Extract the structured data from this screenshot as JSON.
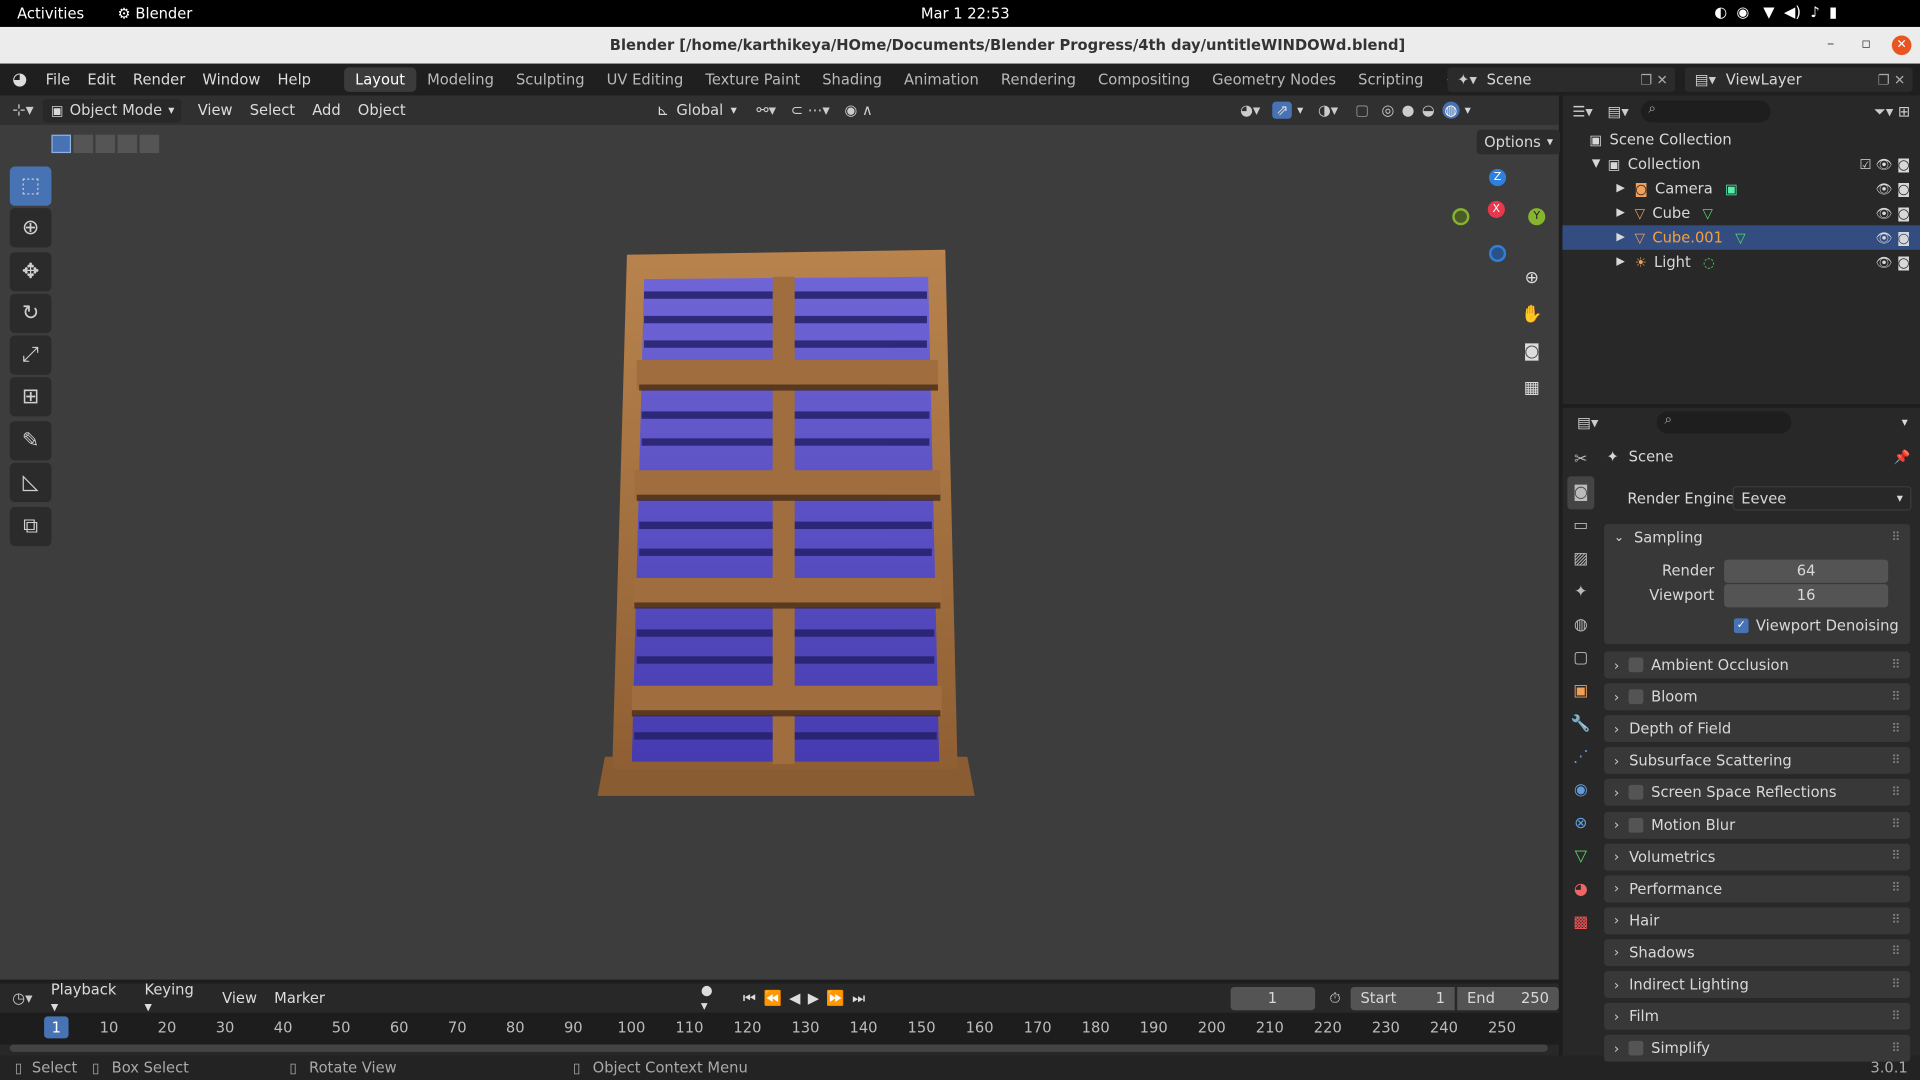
{
  "os": {
    "activities": "Activities",
    "app": "Blender",
    "clock": "Mar 1  22:53"
  },
  "window": {
    "title": "Blender [/home/karthikeya/HOme/Documents/Blender Progress/4th day/untitleWINDOWd.blend]"
  },
  "menu": {
    "items": [
      "File",
      "Edit",
      "Render",
      "Window",
      "Help"
    ]
  },
  "workspaces": {
    "tabs": [
      "Layout",
      "Modeling",
      "Sculpting",
      "UV Editing",
      "Texture Paint",
      "Shading",
      "Animation",
      "Rendering",
      "Compositing",
      "Geometry Nodes",
      "Scripting"
    ],
    "add": "+"
  },
  "scene": {
    "name": "Scene",
    "view_layer": "ViewLayer"
  },
  "viewport": {
    "mode": "Object Mode",
    "menus": [
      "View",
      "Select",
      "Add",
      "Object"
    ],
    "orientation": "Global",
    "options": "Options",
    "gizmo": {
      "x": "X",
      "y": "Y",
      "z": "Z"
    }
  },
  "outliner": {
    "root": "Scene Collection",
    "collection": "Collection",
    "items": [
      {
        "name": "Camera",
        "icon": "camera-icon"
      },
      {
        "name": "Cube",
        "icon": "mesh-icon"
      },
      {
        "name": "Cube.001",
        "icon": "mesh-icon",
        "selected": true
      },
      {
        "name": "Light",
        "icon": "light-icon"
      }
    ]
  },
  "properties": {
    "context": "Scene",
    "render_engine_label": "Render Engine",
    "render_engine": "Eevee",
    "sampling": {
      "label": "Sampling",
      "render_label": "Render",
      "render": "64",
      "viewport_label": "Viewport",
      "viewport": "16",
      "denoise": "Viewport Denoising"
    },
    "panels": [
      {
        "label": "Ambient Occlusion",
        "checkbox": true
      },
      {
        "label": "Bloom",
        "checkbox": true
      },
      {
        "label": "Depth of Field",
        "checkbox": false
      },
      {
        "label": "Subsurface Scattering",
        "checkbox": false
      },
      {
        "label": "Screen Space Reflections",
        "checkbox": true
      },
      {
        "label": "Motion Blur",
        "checkbox": true
      },
      {
        "label": "Volumetrics",
        "checkbox": false
      },
      {
        "label": "Performance",
        "checkbox": false
      },
      {
        "label": "Hair",
        "checkbox": false
      },
      {
        "label": "Shadows",
        "checkbox": false
      },
      {
        "label": "Indirect Lighting",
        "checkbox": false
      },
      {
        "label": "Film",
        "checkbox": false
      },
      {
        "label": "Simplify",
        "checkbox": true
      }
    ]
  },
  "timeline": {
    "menus": [
      "Playback",
      "Keying",
      "View",
      "Marker"
    ],
    "current_frame": "1",
    "start_label": "Start",
    "start": "1",
    "end_label": "End",
    "end": "250",
    "ruler": [
      "1",
      "10",
      "20",
      "30",
      "40",
      "50",
      "60",
      "70",
      "80",
      "90",
      "100",
      "110",
      "120",
      "130",
      "140",
      "150",
      "160",
      "170",
      "180",
      "190",
      "200",
      "210",
      "220",
      "230",
      "240",
      "250"
    ]
  },
  "status": {
    "select": "Select",
    "box_select": "Box Select",
    "rotate": "Rotate View",
    "context_menu": "Object Context Menu",
    "version": "3.0.1"
  },
  "colors": {
    "accent": "#4772b3",
    "frame_wood": "#a06e3e",
    "glass": "#5a4fc8",
    "selected_text": "#f3a23b"
  }
}
